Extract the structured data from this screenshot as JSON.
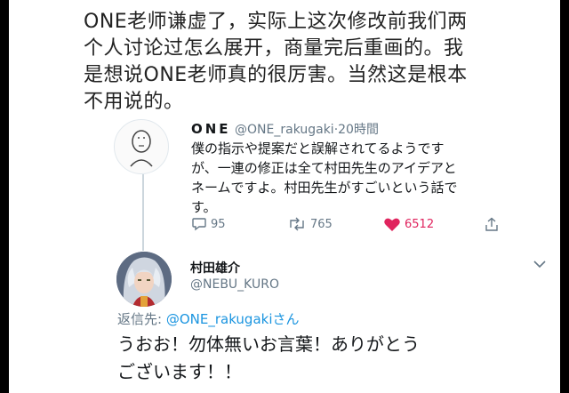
{
  "quote_text": [
    "ONE老师谦虚了，实际上这次修改前我们两",
    "个人讨论过怎么展开，商量完后重画的。我",
    "是想说ONE老师真的很厉害。当然这是根本",
    "不用说的。"
  ],
  "tweet": {
    "name": "ONE",
    "handle": "@ONE_rakugaki",
    "time": "·20時間",
    "lines": [
      "僕の指示や提案だと誤解されてるようです",
      "が、一連の修正は全て村田先生のアイデアと",
      "ネームですよ。村田先生がすごいという話で",
      "す。"
    ],
    "replies": "95",
    "retweets": "765",
    "likes": "6512",
    "like_color": "#e0245e"
  },
  "reply": {
    "name": "村田雄介",
    "handle": "@NEBU_KURO",
    "reply_to_label": "返信先: ",
    "reply_to_handle": "@ONE_rakugaki",
    "reply_to_suffix": "さん",
    "lines": [
      "うおお！勿体無いお言葉！ありがとう",
      "ございます！！"
    ]
  },
  "icons": [
    "reply-icon",
    "retweet-icon",
    "heart-icon",
    "share-icon",
    "chevron-down-icon"
  ],
  "colors": {
    "link": "#1b95e0",
    "muted": "#657786"
  }
}
